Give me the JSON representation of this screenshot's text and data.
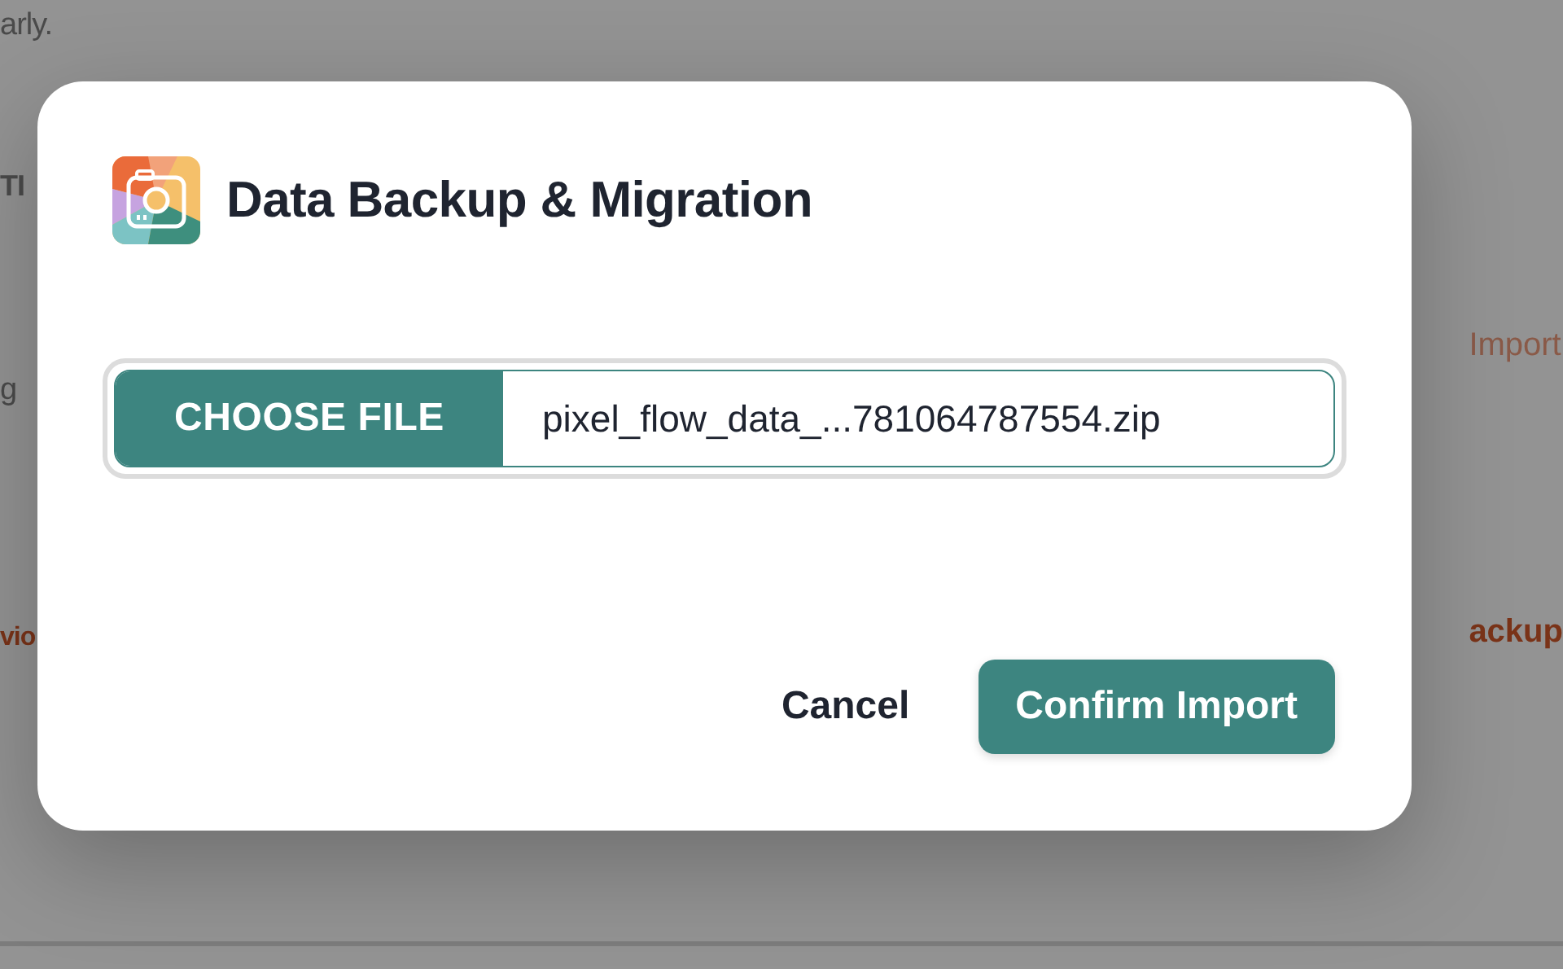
{
  "background": {
    "left": [
      {
        "text": "arly.",
        "kind": "body"
      },
      {
        "text": "TI",
        "kind": "heading"
      },
      {
        "text": "g",
        "kind": "body"
      },
      {
        "text": "vio",
        "kind": "link"
      }
    ],
    "right": [
      {
        "text": "Import",
        "kind": "action"
      },
      {
        "text": "ackup",
        "kind": "link"
      }
    ]
  },
  "dialog": {
    "title": "Data Backup & Migration",
    "file_picker": {
      "button": "CHOOSE FILE",
      "file_name": "pixel_flow_data_...781064787554.zip"
    },
    "buttons": [
      {
        "label": "Cancel",
        "kind": "secondary"
      },
      {
        "label": "Confirm Import",
        "kind": "primary"
      }
    ]
  }
}
